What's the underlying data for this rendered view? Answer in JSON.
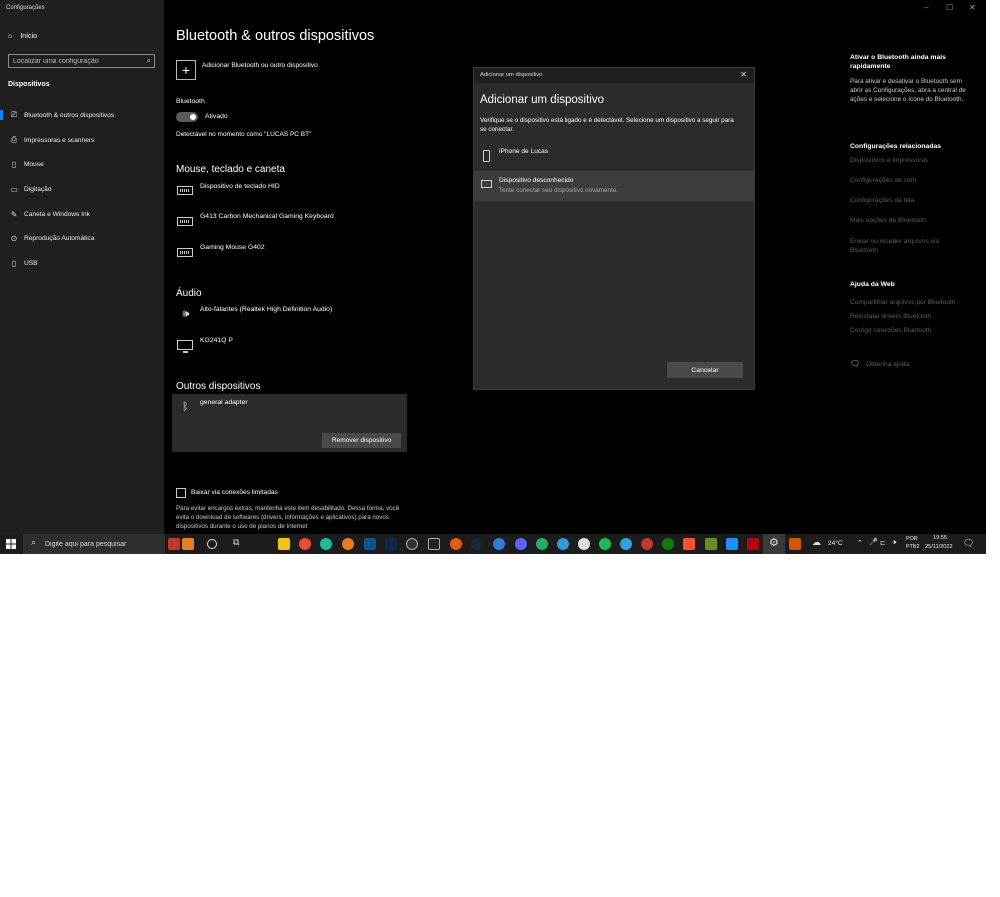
{
  "window": {
    "app_title": "Configurações",
    "minimize": "–",
    "maximize": "☐",
    "close": "✕"
  },
  "sidebar": {
    "home": "Início",
    "search_placeholder": "Localizar uma configuração",
    "section": "Dispositivos",
    "items": [
      {
        "label": "Bluetooth & outros dispositivos",
        "icon": "bluetooth-devices-icon",
        "active": true
      },
      {
        "label": "Impressoras e scanners",
        "icon": "printer-icon"
      },
      {
        "label": "Mouse",
        "icon": "mouse-icon"
      },
      {
        "label": "Digitação",
        "icon": "keyboard-icon"
      },
      {
        "label": "Caneta e Windows Ink",
        "icon": "pen-icon"
      },
      {
        "label": "Reprodução Automática",
        "icon": "autoplay-icon"
      },
      {
        "label": "USB",
        "icon": "usb-icon"
      }
    ]
  },
  "main": {
    "title": "Bluetooth & outros dispositivos",
    "add_device": "Adicionar Bluetooth ou outro dispositivo",
    "bluetooth_label": "Bluetooth",
    "bluetooth_state": "Ativado",
    "discoverable": "Detectável no momento como \"LUCAS PC BT\"",
    "mouse_section": "Mouse, teclado e caneta",
    "mouse_devices": [
      "Dispositivo de teclado HID",
      "G413 Carbon Mechanical Gaming Keyboard",
      "Gaming Mouse G402"
    ],
    "audio_section": "Áudio",
    "audio_devices": [
      "Alto-falantes (Realtek High Definition Audio)",
      "KG241Q P"
    ],
    "other_section": "Outros dispositivos",
    "other_device": "general adapter",
    "remove_button": "Remover dispositivo",
    "metered_label": "Baixar via conexões limitadas",
    "metered_desc": "Para evitar encargos extras, mantenha este item desabilitado. Dessa forma, você evita o download de softwares (drivers, informações e aplicativos) para novos dispositivos durante o uso de planos de Internet"
  },
  "dialog": {
    "titlebar": "Adicionar um dispositivo",
    "close": "✕",
    "heading": "Adicionar um dispositivo",
    "description": "Verifique se o dispositivo está ligado e é detectável. Selecione um dispositivo a seguir para se conectar.",
    "devices": [
      {
        "name": "iPhone de Lucas",
        "sub": ""
      },
      {
        "name": "Dispositivo desconhecido",
        "sub": "Tente conectar seu dispositivo novamente."
      }
    ],
    "cancel": "Cancelar"
  },
  "right": {
    "tip_title": "Ativar o Bluetooth ainda mais rapidamente",
    "tip_text": "Para ativar e desativar o Bluetooth sem abrir as Configurações, abra a central de ações e selecione o ícone do Bluetooth.",
    "related_title": "Configurações relacionadas",
    "related_links": [
      "Dispositivos e impressoras",
      "Configurações de som",
      "Configurações da tela",
      "Mais opções de Bluetooth",
      "Enviar ou receber arquivos via Bluetooth"
    ],
    "web_title": "Ajuda da Web",
    "web_links": [
      "Compartilhar arquivos por Bluetooth",
      "Reinstalar drivers Bluetooth",
      "Corrigir conexões Bluetooth"
    ],
    "help": "Obtenha ajuda"
  },
  "taskbar": {
    "search_placeholder": "Digite aqui para pesquisar",
    "weather": "24°C",
    "lang_top": "POR",
    "lang_bottom": "PTB2",
    "time": "19:55",
    "date": "25/11/2022"
  }
}
